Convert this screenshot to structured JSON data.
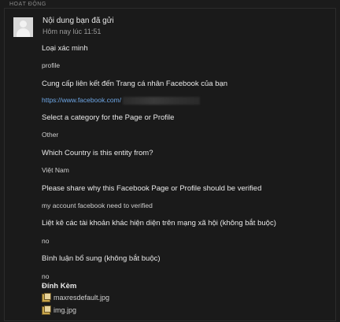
{
  "section_label": "HOẠT ĐỘNG",
  "header": {
    "title": "Nội dung bạn đã gửi",
    "time": "Hôm nay lúc 11:51"
  },
  "fields": [
    {
      "question": "Loại xác minh",
      "answer": "profile"
    },
    {
      "question": "Cung cấp liên kết đến Trang cá nhân Facebook của bạn",
      "answer": "https://www.facebook.com/"
    },
    {
      "question": "Select a category for the Page or Profile",
      "answer": "Other"
    },
    {
      "question": "Which Country is this entity from?",
      "answer": "Việt Nam"
    },
    {
      "question": "Please share why this Facebook Page or Profile should be verified",
      "answer": "my account facebook need to verified"
    },
    {
      "question": "Liệt kê các tài khoản khác hiện diện trên mạng xã hội (không bắt buộc)",
      "answer": "no"
    },
    {
      "question": "Bình luận bổ sung (không bắt buộc)",
      "answer": "no"
    }
  ],
  "attachments": {
    "title": "Đính Kèm",
    "files": [
      "maxresdefault.jpg",
      "img.jpg"
    ]
  }
}
